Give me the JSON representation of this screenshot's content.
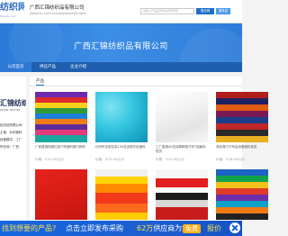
{
  "header": {
    "logo_text": "纺织网",
    "logo_sub": "fangzhi.net",
    "company_name": "广西汇锦纺织品有限公司",
    "company_url": "www.tnc.com.cn/company/hjfz.html",
    "search_placeholder": "请输入产品名称或关键字搜索",
    "search_button": "搜全网",
    "search_site_button": "搜本站"
  },
  "banner": {
    "title": "广西汇锦纺织品有限公司"
  },
  "nav": {
    "items": [
      {
        "label": "公司首页"
      },
      {
        "label": "供应产品"
      },
      {
        "label": "企业介绍"
      }
    ]
  },
  "sidebar": {
    "logo_text": "汇锦纺织",
    "logo_sub": "HUIJIN TEXTILE",
    "lines": [
      "纺织品有限公司",
      "主营：针织面料",
      "经营模式：工厂",
      "所在地：广西"
    ]
  },
  "main": {
    "section_title": "产品",
    "products": [
      {
        "caption": "厂家直销纯棉拉架汗布面料弹力棉布",
        "price": "价格：￥22.00/公斤"
      },
      {
        "caption": "针织布定制定染100支全棉平纹面料",
        "price": "价格：￥21.00/公斤"
      },
      {
        "caption": "工厂直销40支纯棉精梳汗布T恤面料现货",
        "price": "价格：￥22.00/公斤"
      },
      {
        "caption": "涤纶弹力汗布运动服面料批发",
        "price": "价格：￥18.00/公斤"
      },
      {
        "caption": "",
        "price": ""
      },
      {
        "caption": "",
        "price": ""
      },
      {
        "caption": "",
        "price": ""
      },
      {
        "caption": "",
        "price": ""
      }
    ]
  },
  "ad": {
    "text1": "找到想要的产品?",
    "text2": "点击立即发布采购",
    "text3_num": "6",
    "text3_num2": "2万",
    "text3_rest": "供应商为您",
    "badge": "免费",
    "text4": "报价"
  }
}
